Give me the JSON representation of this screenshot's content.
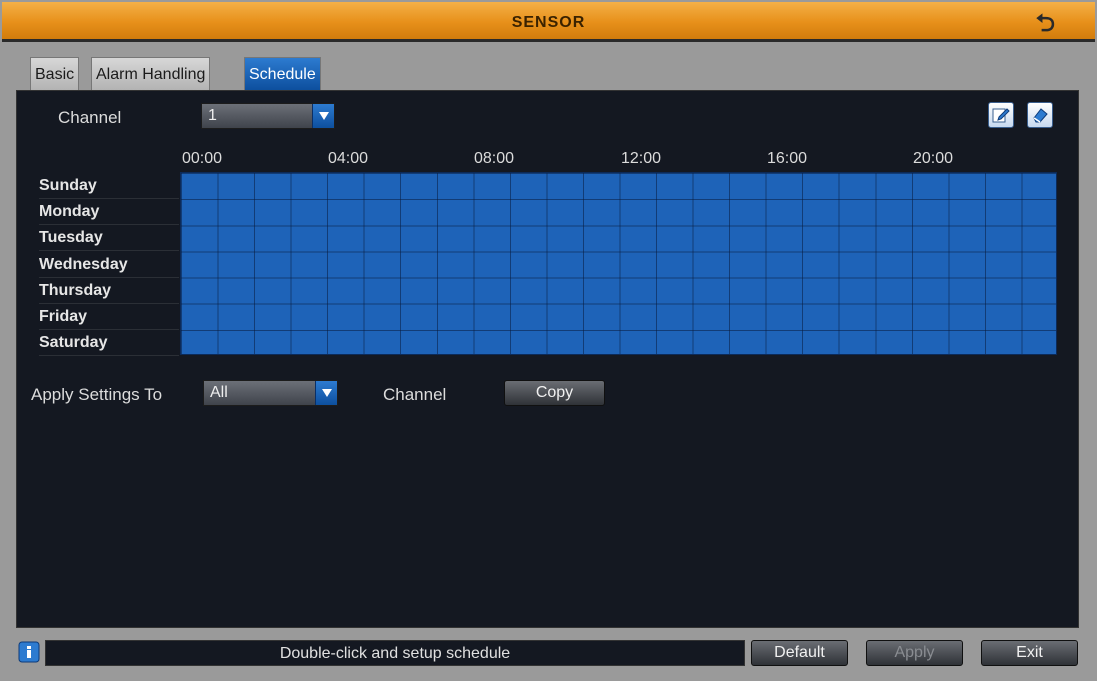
{
  "window": {
    "title": "SENSOR"
  },
  "tabs": [
    {
      "label": "Basic",
      "active": false
    },
    {
      "label": "Alarm Handling",
      "active": false
    },
    {
      "label": "Schedule",
      "active": true
    }
  ],
  "channel": {
    "label": "Channel",
    "value": "1"
  },
  "schedule": {
    "hours": [
      "00:00",
      "04:00",
      "08:00",
      "12:00",
      "16:00",
      "20:00"
    ],
    "days": [
      "Sunday",
      "Monday",
      "Tuesday",
      "Wednesday",
      "Thursday",
      "Friday",
      "Saturday"
    ]
  },
  "apply": {
    "label": "Apply Settings To",
    "value": "All",
    "channel_label": "Channel",
    "copy_label": "Copy"
  },
  "footer": {
    "status": "Double-click and setup schedule",
    "default_label": "Default",
    "apply_label": "Apply",
    "exit_label": "Exit"
  },
  "colors": {
    "title_bar": "#e7901a",
    "active_tab": "#1e63b8",
    "schedule_fill": "#1e63b8",
    "panel_bg": "#141821"
  }
}
